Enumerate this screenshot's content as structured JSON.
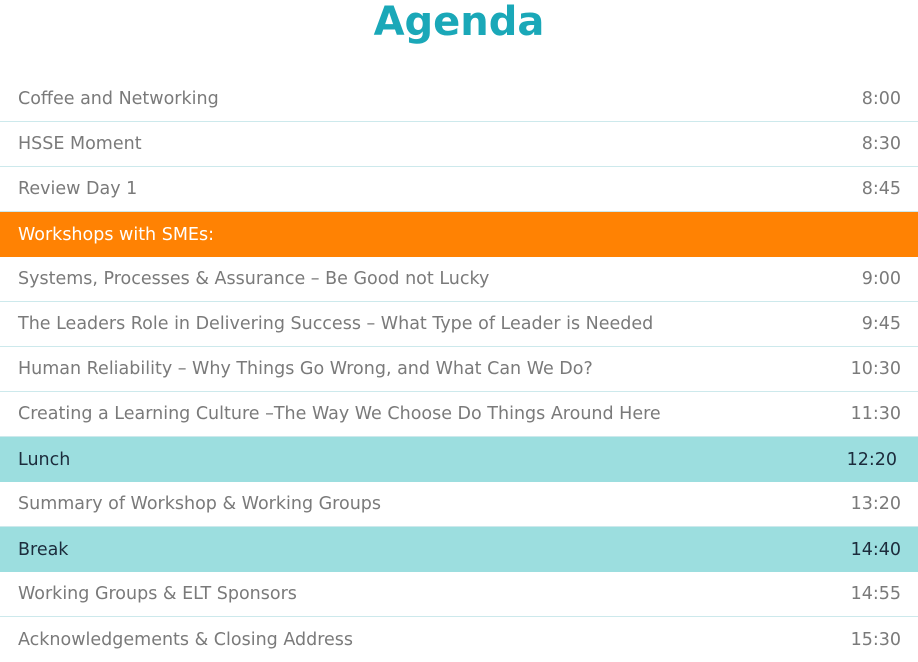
{
  "title": "Agenda",
  "colors": {
    "title": "#1aa8b8",
    "section_bg": "#ff8203",
    "break_bg": "#9cdedf",
    "row_divider": "#cde9ec",
    "item_text": "#7a7a7a"
  },
  "rows": [
    {
      "label": "Coffee and Networking",
      "time": "8:00",
      "kind": "item"
    },
    {
      "label": "HSSE Moment",
      "time": "8:30",
      "kind": "item"
    },
    {
      "label": "Review Day 1",
      "time": "8:45",
      "kind": "item"
    },
    {
      "label": "Workshops with SMEs:",
      "time": "",
      "kind": "section"
    },
    {
      "label": "Systems, Processes & Assurance – Be Good not Lucky",
      "time": "9:00",
      "kind": "item"
    },
    {
      "label": "The Leaders Role in Delivering Success – What Type of Leader is Needed",
      "time": "9:45",
      "kind": "item"
    },
    {
      "label": "Human Reliability – Why Things Go Wrong, and What Can We Do?",
      "time": "10:30",
      "kind": "item"
    },
    {
      "label": "Creating a Learning Culture –The Way We Choose Do Things Around Here",
      "time": "11:30",
      "kind": "item"
    },
    {
      "label": "Lunch",
      "time": "12:20",
      "kind": "break"
    },
    {
      "label": "Summary of Workshop & Working Groups",
      "time": "13:20",
      "kind": "item"
    },
    {
      "label": "Break",
      "time": "14:40",
      "kind": "break"
    },
    {
      "label": "Working Groups & ELT Sponsors",
      "time": "14:55",
      "kind": "item"
    },
    {
      "label": "Acknowledgements & Closing Address",
      "time": "15:30",
      "kind": "item"
    }
  ]
}
